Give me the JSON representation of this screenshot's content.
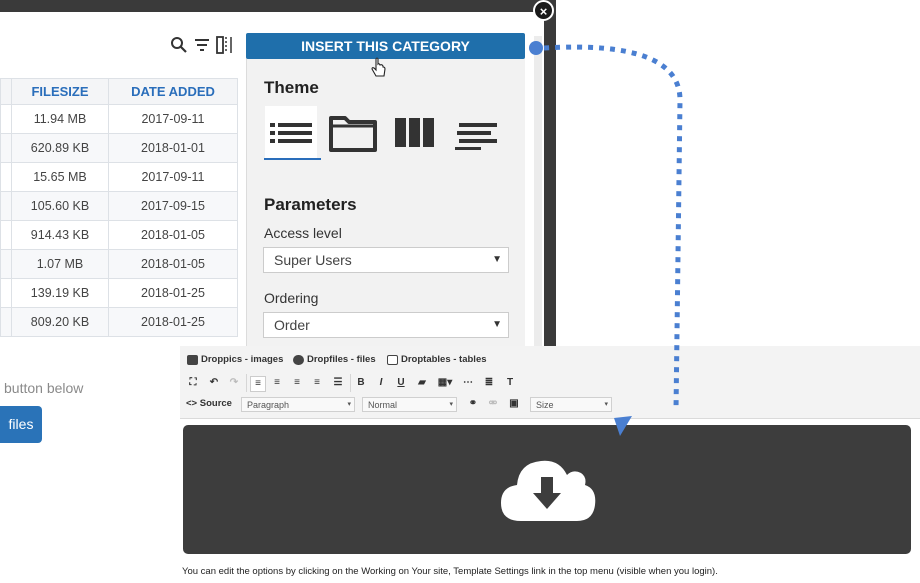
{
  "modal": {
    "close_label": "×",
    "insert_button": "INSERT THIS CATEGORY",
    "table": {
      "headers": [
        "FILESIZE",
        "DATE ADDED"
      ],
      "rows": [
        {
          "size": "11.94 MB",
          "date": "2017-09-11"
        },
        {
          "size": "620.89 KB",
          "date": "2018-01-01"
        },
        {
          "size": "15.65 MB",
          "date": "2017-09-11"
        },
        {
          "size": "105.60 KB",
          "date": "2017-09-15"
        },
        {
          "size": "914.43 KB",
          "date": "2018-01-05"
        },
        {
          "size": "1.07 MB",
          "date": "2018-01-05"
        },
        {
          "size": "139.19 KB",
          "date": "2018-01-25"
        },
        {
          "size": "809.20 KB",
          "date": "2018-01-25"
        }
      ]
    },
    "hint_text": "button below",
    "files_button": "files",
    "theme_title": "Theme",
    "themes": [
      "list-icon",
      "folder-icon",
      "columns-icon",
      "align-left-icon"
    ],
    "parameters_title": "Parameters",
    "access_label": "Access level",
    "access_value": "Super Users",
    "ordering_label": "Ordering",
    "ordering_value": "Order"
  },
  "editor": {
    "plugins": [
      "Droppics - images",
      "Dropfiles - files",
      "Droptables - tables"
    ],
    "toolbar_row1": [
      "fullscreen-icon",
      "undo-icon",
      "redo-icon",
      "align-left-icon",
      "align-right-icon",
      "align-center-icon",
      "justify-icon",
      "list-icon",
      "B",
      "I",
      "U",
      "folder-icon",
      "table-icon",
      "hr-icon",
      "paragraph-icon",
      "format-icon"
    ],
    "source_label": "Source",
    "format_select": "Paragraph",
    "font_select": "Normal",
    "size_select": "Size",
    "footer_text": "You can edit the options by clicking on the Working on Your site, Template Settings link in the top menu (visible when you login)."
  },
  "colors": {
    "accent": "#1f6fab",
    "connector": "#4a7fd1",
    "dark": "#3d3d3d"
  }
}
